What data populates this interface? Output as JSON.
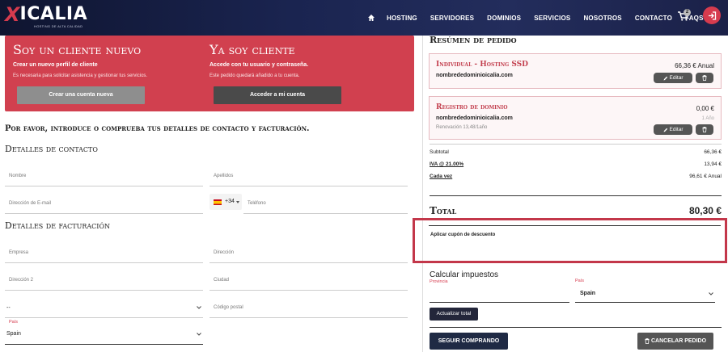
{
  "header": {
    "logo_mark": "X",
    "logo_text": "ICALIA",
    "logo_tagline": "HOSTING DE ALTA CALIDAD",
    "nav": [
      "HOSTING",
      "SERVIDORES",
      "DOMINIOS",
      "SERVICIOS",
      "NOSOTROS",
      "CONTACTO",
      "FAQS"
    ],
    "cart_count": "2",
    "icons": {
      "home": "home-icon",
      "cart": "cart-icon",
      "login": "sign-in-icon"
    }
  },
  "banner": {
    "new_client": {
      "title": "Soy un cliente nuevo",
      "subtitle": "Crear un nuevo perfil de cliente",
      "desc": "Es necesaria para solicitar asistencia y gestionar tus servicios.",
      "button": "Crear una cuenta nueva"
    },
    "existing_client": {
      "title": "Ya soy cliente",
      "subtitle": "Accede con tu usuario y contraseña.",
      "desc": "Este pedido quedará añadido a tu cuenta.",
      "button": "Acceder a mi cuenta"
    },
    "color": "#d1404f"
  },
  "form": {
    "instruction": "Por favor, introduce o comprueba tus detalles de contacto y facturación.",
    "contact_title": "Detalles de contacto",
    "billing_title": "Detalles de facturación",
    "fields": {
      "nombre": "Nombre",
      "apellidos": "Apellidos",
      "email": "Dirección de E-mail",
      "phone_prefix": "+34",
      "telefono": "Teléfono",
      "empresa": "Empresa",
      "direccion": "Dirección",
      "direccion2": "Dirección 2",
      "ciudad": "Ciudad",
      "state_value": "--",
      "codigo_postal": "Código postal",
      "pais_label": "País",
      "pais_value": "Spain"
    }
  },
  "summary": {
    "title": "Resúmen de pedido",
    "items": [
      {
        "title": "Individual - Hosting SSD",
        "domain": "nombrededominioicalia.com",
        "price": "66,36 € Anual",
        "edit": "Editar"
      },
      {
        "title": "Registro de dominio",
        "domain": "nombrededominioicalia.com",
        "renewal": "Renovación 13,48/1año",
        "price": "0,00 €",
        "period": "1 Año",
        "edit": "Editar"
      }
    ],
    "subtotal_label": "Subtotal",
    "subtotal": "66,36 €",
    "iva_label": "IVA @ 21.00%",
    "iva": "13,94 €",
    "cada_vez_label": "Cada vez",
    "cada_vez": "96,61 € Anual",
    "total_label": "Total",
    "total": "80,30 €",
    "coupon_label": "Aplicar cupón de descuento",
    "tax_title": "Calcular impuestos",
    "provincia_label": "Provincia",
    "pais_label": "País",
    "pais_value": "Spain",
    "update_button": "Actualizar total",
    "continue_button": "SEGUIR COMPRANDO",
    "cancel_button": "CANCELAR PEDIDO",
    "accent_color": "#c3374a"
  }
}
